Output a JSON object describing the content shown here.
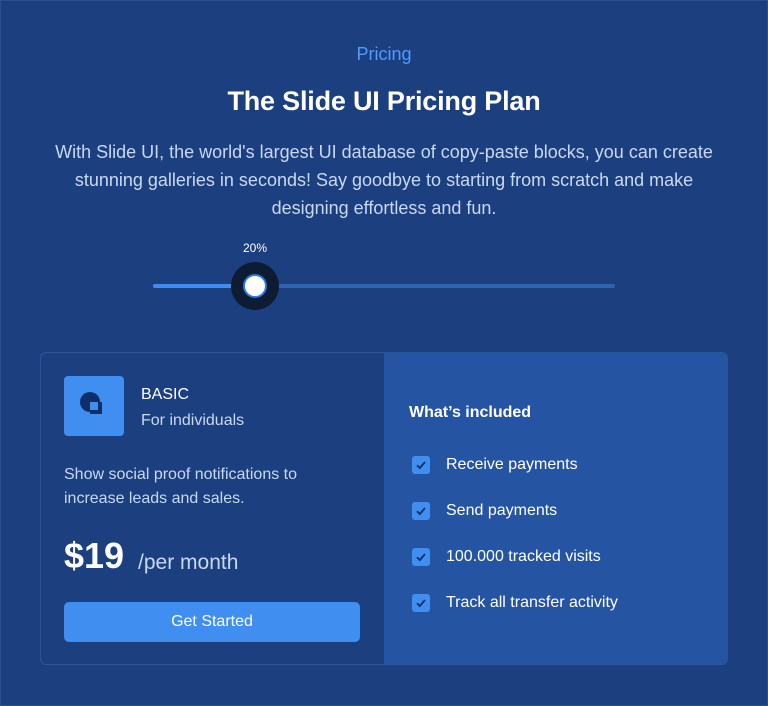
{
  "header": {
    "eyebrow": "Pricing",
    "title": "The Slide UI Pricing Plan",
    "description": "With Slide UI, the world's largest UI database of copy-paste blocks, you can create stunning galleries in seconds! Say goodbye to starting from scratch and make designing effortless and fun."
  },
  "slider": {
    "value_label": "20%",
    "value_fraction": 0.22
  },
  "plan": {
    "icon": "plan-logo-icon",
    "name": "BASIC",
    "audience": "For individuals",
    "description": "Show social proof notifications to increase leads and sales.",
    "price": "$19",
    "period": "/per month",
    "cta_label": "Get Started"
  },
  "included": {
    "title": "What’s included",
    "items": [
      "Receive payments",
      "Send payments",
      "100.000 tracked visits",
      "Track all transfer activity"
    ]
  },
  "colors": {
    "background": "#1c3f7f",
    "accent": "#3f8ef0",
    "panel": "#2554a3"
  }
}
